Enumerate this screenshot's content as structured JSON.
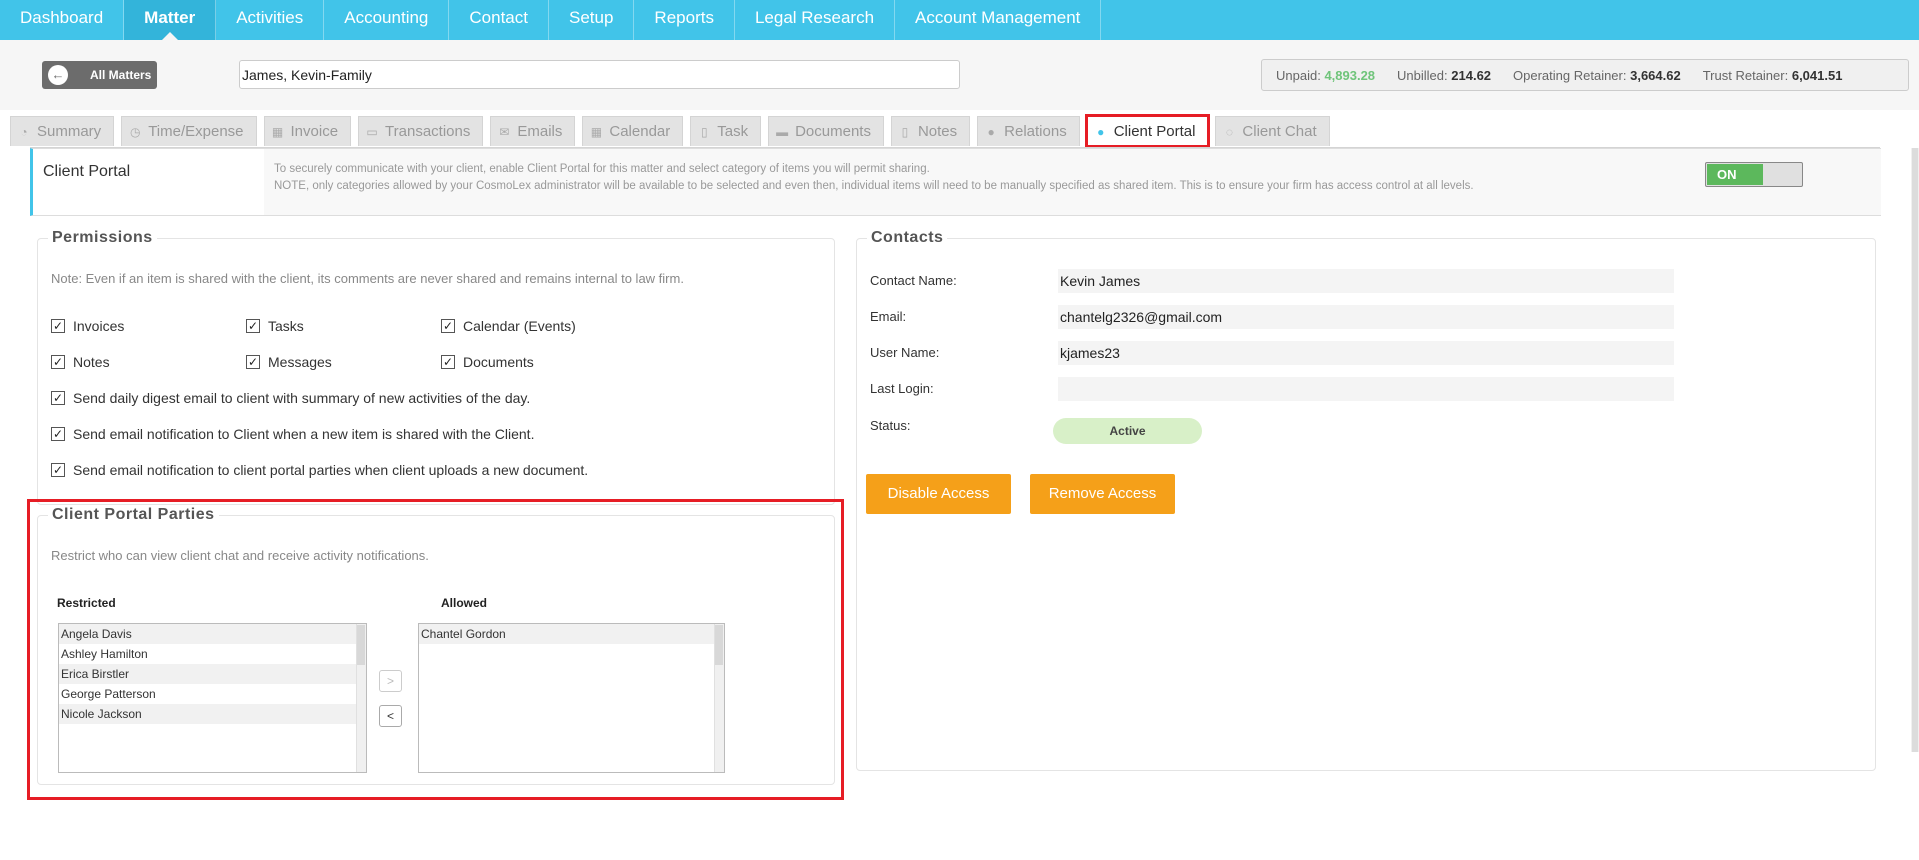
{
  "nav": {
    "items": [
      "Dashboard",
      "Matter",
      "Activities",
      "Accounting",
      "Contact",
      "Setup",
      "Reports",
      "Legal Research",
      "Account Management"
    ],
    "active": "Matter"
  },
  "header": {
    "all_matters_label": "All Matters",
    "matter_name": "James, Kevin-Family",
    "balances": {
      "unpaid_label": "Unpaid:",
      "unpaid": "4,893.28",
      "unbilled_label": "Unbilled:",
      "unbilled": "214.62",
      "operating_label": "Operating Retainer:",
      "operating": "3,664.62",
      "trust_label": "Trust Retainer:",
      "trust": "6,041.51"
    }
  },
  "tabs": [
    {
      "label": "Summary",
      "icon": "dashboard-icon"
    },
    {
      "label": "Time/Expense",
      "icon": "clock-icon"
    },
    {
      "label": "Invoice",
      "icon": "calculator-icon"
    },
    {
      "label": "Transactions",
      "icon": "credit-card-icon"
    },
    {
      "label": "Emails",
      "icon": "envelope-icon"
    },
    {
      "label": "Calendar",
      "icon": "calendar-icon"
    },
    {
      "label": "Task",
      "icon": "file-icon"
    },
    {
      "label": "Documents",
      "icon": "folder-icon"
    },
    {
      "label": "Notes",
      "icon": "note-icon"
    },
    {
      "label": "Relations",
      "icon": "users-icon"
    },
    {
      "label": "Client Portal",
      "icon": "client-portal-icon"
    },
    {
      "label": "Client Chat",
      "icon": "chat-icon"
    }
  ],
  "portal": {
    "title": "Client Portal",
    "desc1": "To securely communicate with your client, enable Client Portal for this matter and select category of items you will permit sharing.",
    "desc2": "NOTE, only categories allowed by your CosmoLex administrator will be available to be selected and even then, individual items will need to be manually specified as shared item. This is to ensure your firm has access control at all levels.",
    "toggle_label": "ON"
  },
  "permissions": {
    "legend": "Permissions",
    "note": "Note: Even if an item is shared with the client, its comments are never shared and remains internal to law firm.",
    "checkboxes": [
      "Invoices",
      "Tasks",
      "Calendar (Events)",
      "Notes",
      "Messages",
      "Documents"
    ],
    "options": [
      "Send daily digest email to client with summary of new activities of the day.",
      "Send email notification to Client when a new item is shared with the Client.",
      "Send email notification to client portal parties when client uploads a new document."
    ],
    "checked_mark": "✓"
  },
  "parties": {
    "legend": "Client Portal Parties",
    "note": "Restrict who can view client chat and receive activity notifications.",
    "restricted_label": "Restricted",
    "allowed_label": "Allowed",
    "restricted": [
      "Angela Davis",
      "Ashley Hamilton",
      "Erica Birstler",
      "George Patterson",
      "Nicole Jackson"
    ],
    "allowed": [
      "Chantel Gordon"
    ],
    "move_right": ">",
    "move_left": "<"
  },
  "contacts": {
    "legend": "Contacts",
    "name_label": "Contact Name:",
    "name": "Kevin James",
    "email_label": "Email:",
    "email": "chantelg2326@gmail.com",
    "user_label": "User Name:",
    "user": "kjames23",
    "login_label": "Last Login:",
    "login": "",
    "status_label": "Status:",
    "status": "Active",
    "disable_btn": "Disable Access",
    "remove_btn": "Remove Access"
  }
}
